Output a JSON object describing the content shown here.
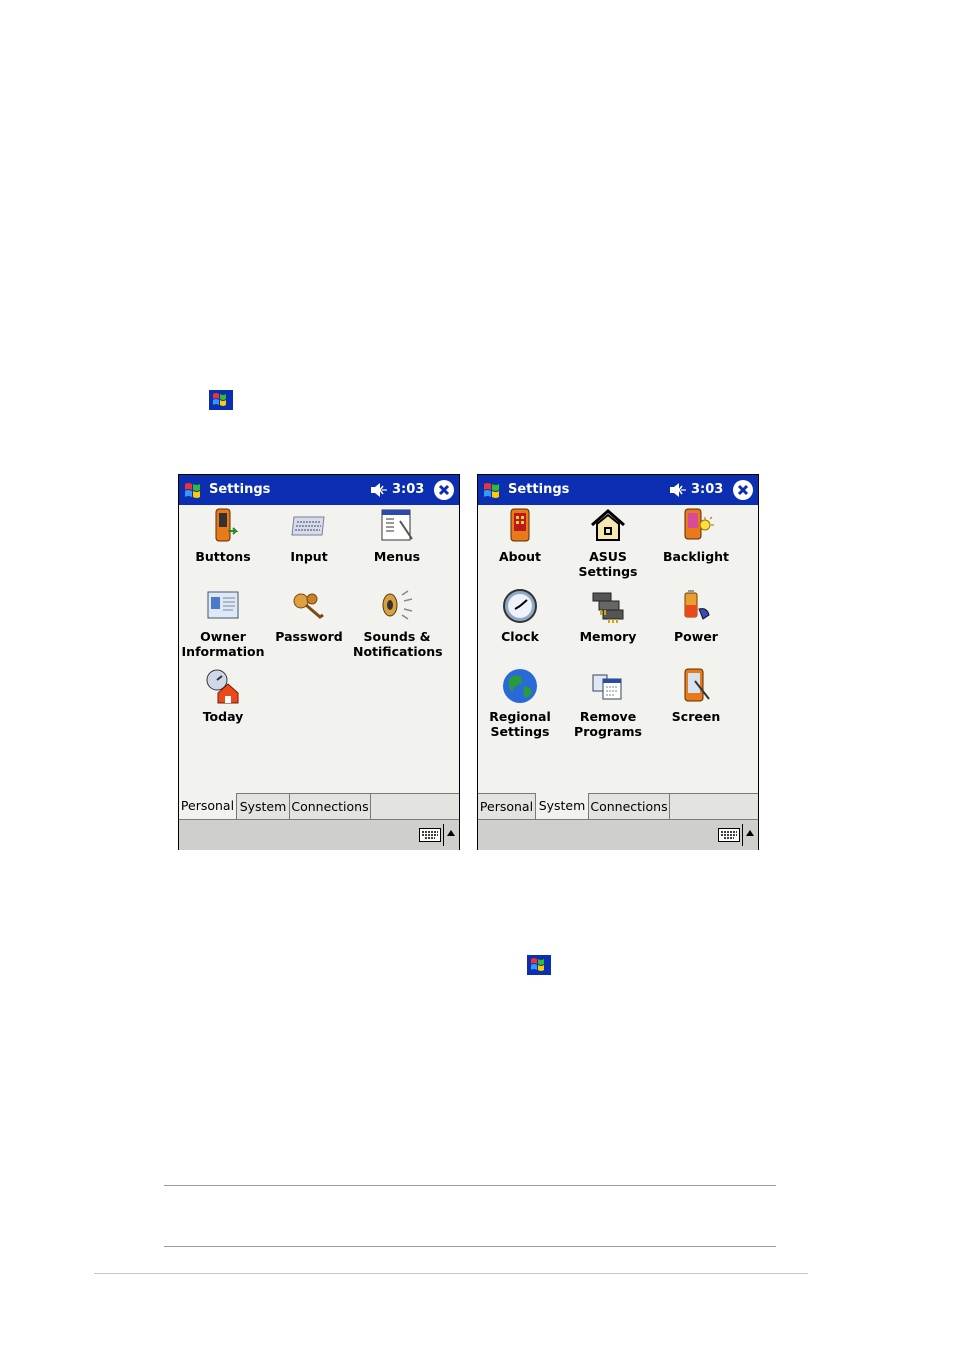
{
  "screens": [
    {
      "title": "Settings",
      "time": "3:03",
      "items": [
        {
          "label": "Buttons",
          "icon": "buttons-icon"
        },
        {
          "label": "Input",
          "icon": "keyboard-icon"
        },
        {
          "label": "Menus",
          "icon": "menus-icon"
        },
        {
          "label": "Owner\nInformation",
          "icon": "owner-card-icon"
        },
        {
          "label": "Password",
          "icon": "keys-icon"
        },
        {
          "label": "Sounds &\nNotifications",
          "icon": "speaker-icon"
        },
        {
          "label": "Today",
          "icon": "today-icon"
        }
      ],
      "tabs": [
        "Personal",
        "System",
        "Connections"
      ],
      "active_tab": "Personal"
    },
    {
      "title": "Settings",
      "time": "3:03",
      "items": [
        {
          "label": "About",
          "icon": "device-icon"
        },
        {
          "label": "ASUS\nSettings",
          "icon": "house-icon"
        },
        {
          "label": "Backlight",
          "icon": "backlight-icon"
        },
        {
          "label": "Clock",
          "icon": "clock-icon"
        },
        {
          "label": "Memory",
          "icon": "memory-chips-icon"
        },
        {
          "label": "Power",
          "icon": "battery-icon"
        },
        {
          "label": "Regional\nSettings",
          "icon": "globe-icon"
        },
        {
          "label": "Remove\nPrograms",
          "icon": "remove-programs-icon"
        },
        {
          "label": "Screen",
          "icon": "screen-stylus-icon"
        }
      ],
      "tabs": [
        "Personal",
        "System",
        "Connections"
      ],
      "active_tab": "System"
    }
  ],
  "colors": {
    "titlebar": "#0b2fb0",
    "background": "#f2f2ef",
    "menubar": "#cfcfcc"
  }
}
